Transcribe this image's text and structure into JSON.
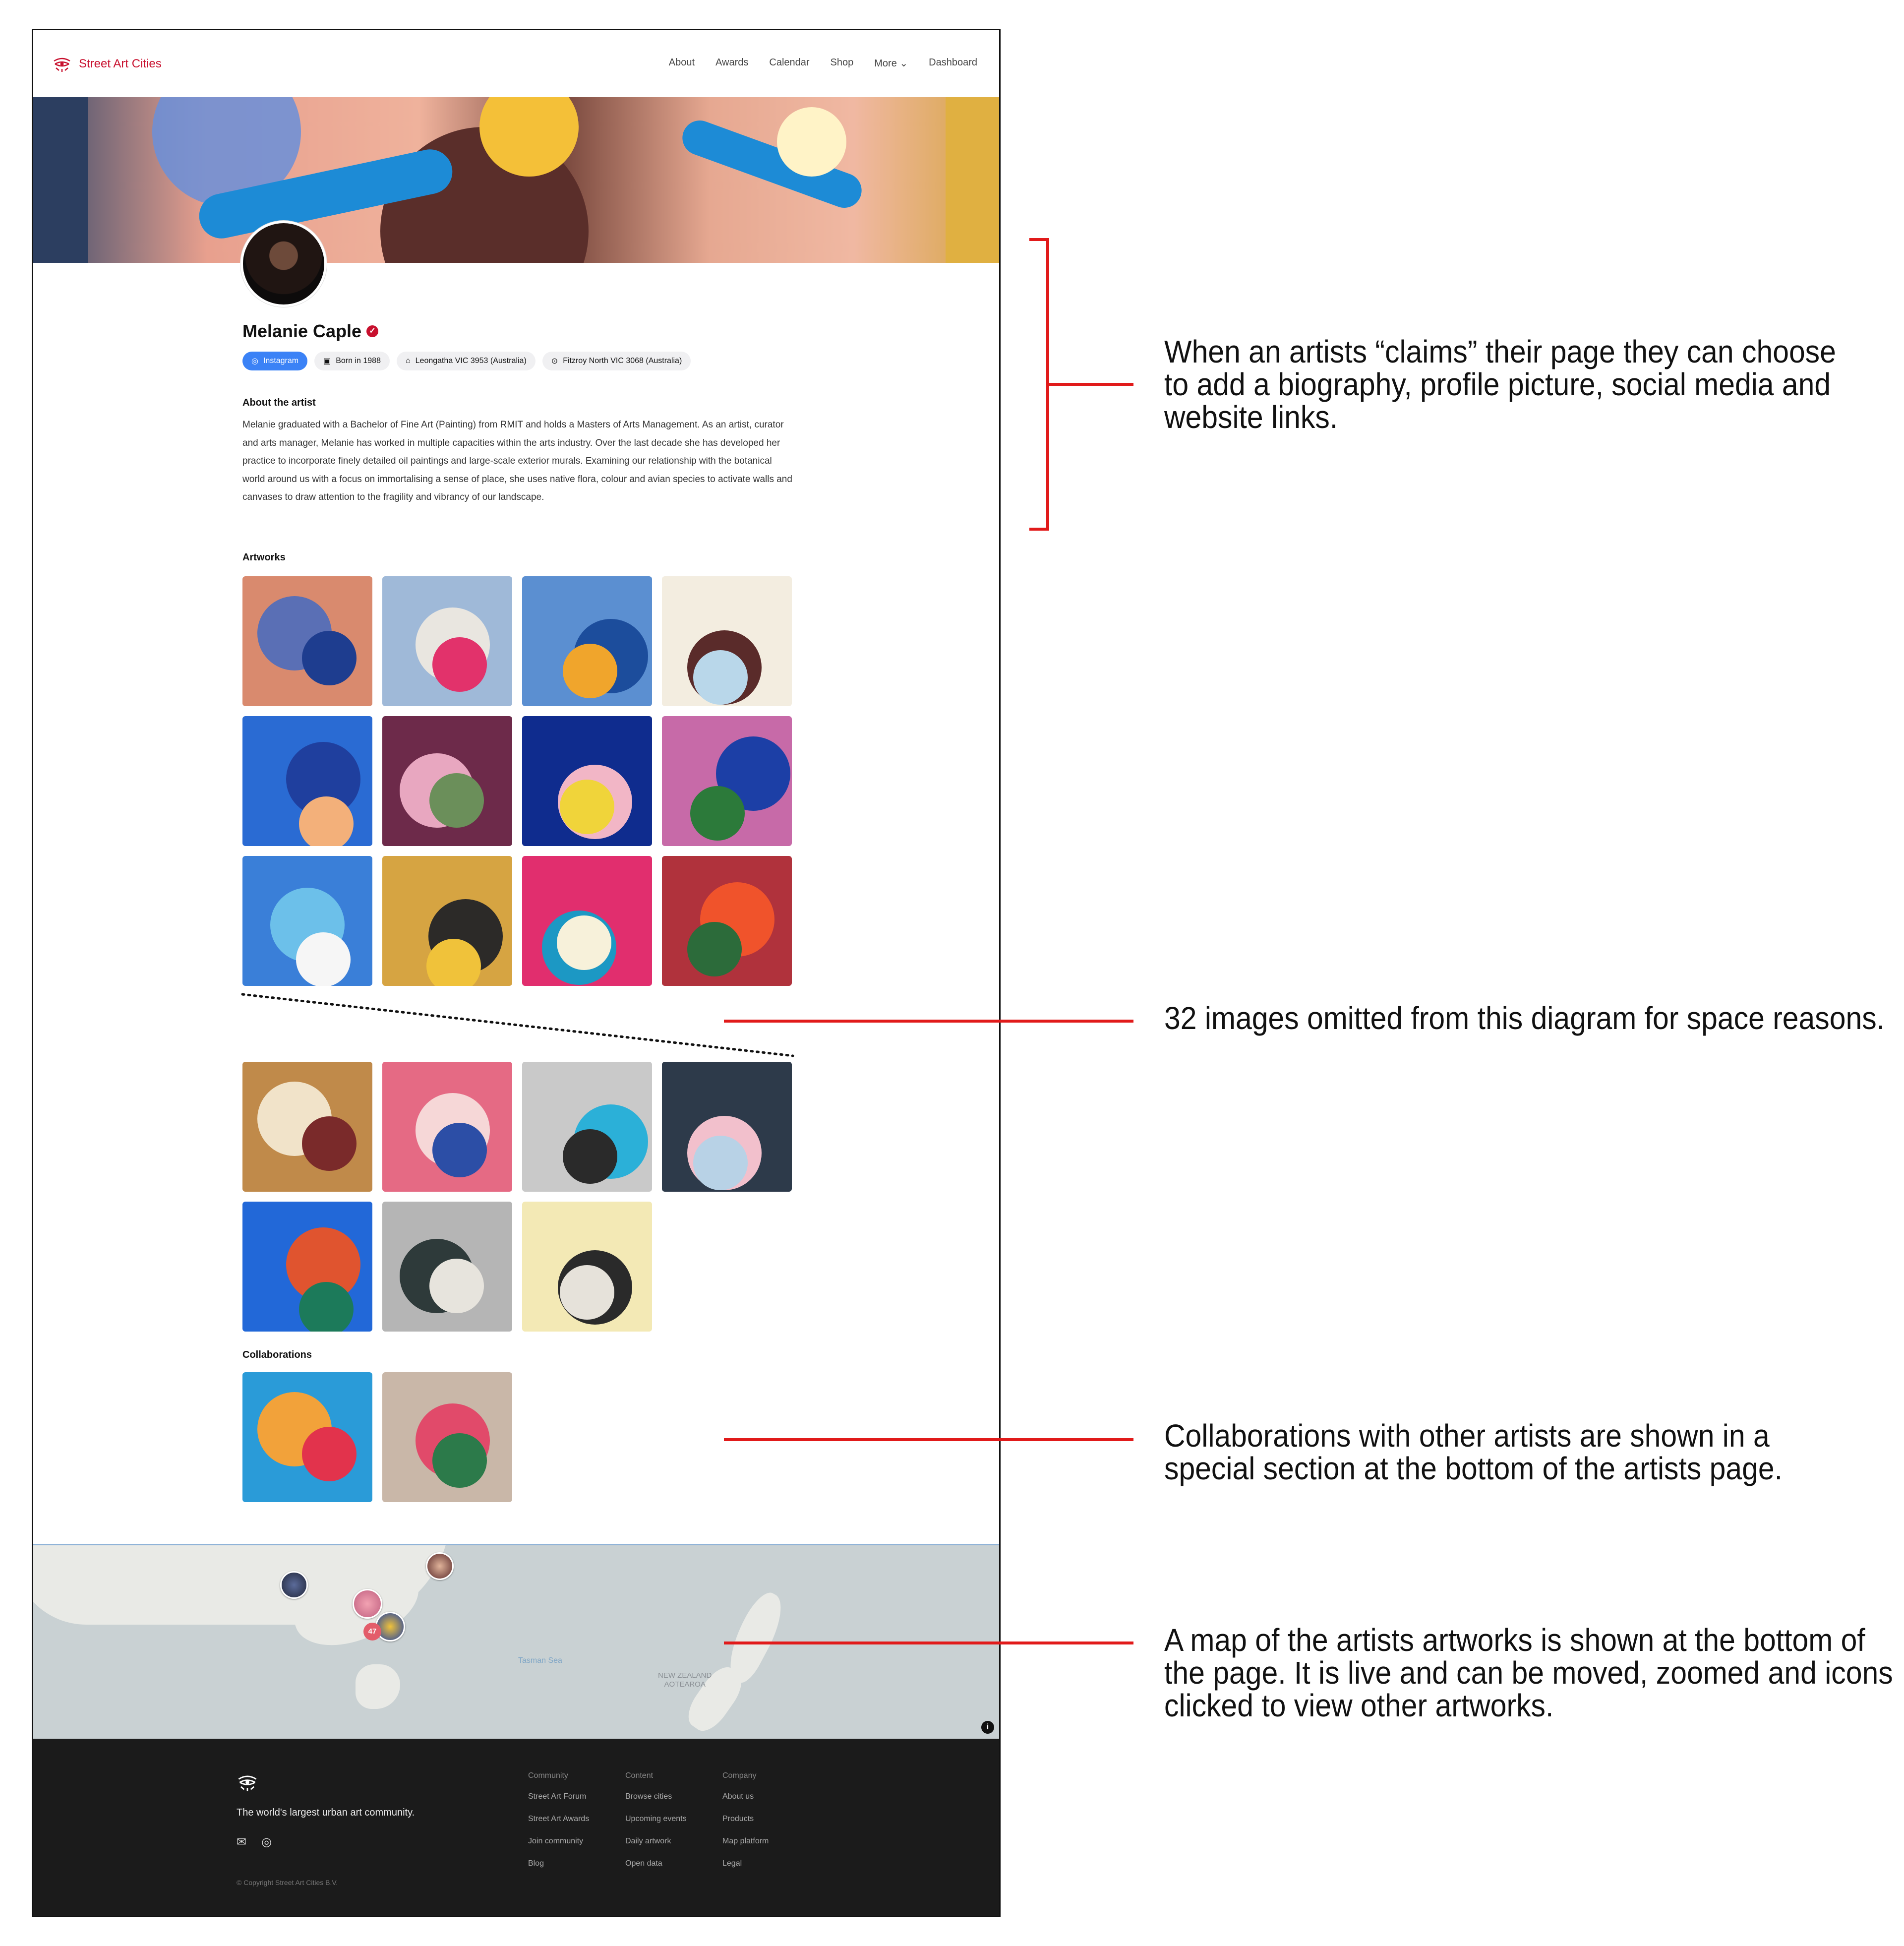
{
  "header": {
    "brand": "Street Art Cities",
    "nav": [
      "About",
      "Awards",
      "Calendar",
      "Shop",
      "More ⌄",
      "Dashboard"
    ]
  },
  "profile": {
    "name": "Melanie Caple",
    "chips": {
      "instagram": "Instagram",
      "born": "Born in 1988",
      "home": "Leongatha VIC 3953 (Australia)",
      "location": "Fitzroy North VIC 3068 (Australia)"
    },
    "about_title": "About the artist",
    "bio": "Melanie graduated with a Bachelor of Fine Art (Painting) from RMIT and holds a Masters of Arts Management. As an artist, curator and arts manager, Melanie has worked in multiple capacities within the arts industry. Over the last decade she has developed her practice to incorporate finely detailed oil paintings and large-scale exterior murals. Examining our relationship with the botanical world around us with a focus on immortalising a sense of place, she uses native flora, colour and avian species to activate walls and canvases to draw attention to the fragility and vibrancy of our landscape."
  },
  "artworks_title": "Artworks",
  "artworks_top": [
    {
      "c": [
        "#d98a6e",
        "#5a6fb5",
        "#1e3d8f"
      ]
    },
    {
      "c": [
        "#9fb9d8",
        "#e9e6e0",
        "#e2326b"
      ]
    },
    {
      "c": [
        "#5b8fd1",
        "#1c4d9c",
        "#f0a52c"
      ]
    },
    {
      "c": [
        "#f3ede0",
        "#5a2b2a",
        "#b9d7ea"
      ]
    },
    {
      "c": [
        "#2a6bd3",
        "#1f3f9e",
        "#f3b07a"
      ]
    },
    {
      "c": [
        "#6d2a4a",
        "#e8a7c0",
        "#6b8f5a"
      ]
    },
    {
      "c": [
        "#0f2c8e",
        "#f2b6c6",
        "#f0d43a"
      ]
    },
    {
      "c": [
        "#c76aa8",
        "#1c3fa6",
        "#2c7a3a"
      ]
    },
    {
      "c": [
        "#3a7fd8",
        "#6cc0ea",
        "#f6f6f6"
      ]
    },
    {
      "c": [
        "#d6a442",
        "#2c2a28",
        "#f0c23a"
      ]
    },
    {
      "c": [
        "#e12e6e",
        "#1c98c4",
        "#f7f1da"
      ]
    },
    {
      "c": [
        "#b0323c",
        "#f0532b",
        "#2c6b3a"
      ]
    }
  ],
  "artworks_bottom": [
    {
      "c": [
        "#c08a4a",
        "#f1e3c9",
        "#7a2a2a"
      ]
    },
    {
      "c": [
        "#e56a84",
        "#f6d7d7",
        "#2c4ea6"
      ]
    },
    {
      "c": [
        "#c9c9c9",
        "#2bb0d8",
        "#2a2a2a"
      ]
    },
    {
      "c": [
        "#2d3a4a",
        "#f2c0cc",
        "#b8d2e6"
      ]
    },
    {
      "c": [
        "#2268d8",
        "#e0542f",
        "#1c7a5a"
      ]
    },
    {
      "c": [
        "#b5b5b5",
        "#2e3a3a",
        "#e7e4dd"
      ]
    },
    {
      "c": [
        "#f3e9b5",
        "#2a2a2a",
        "#e6e2da"
      ]
    }
  ],
  "collaborations_title": "Collaborations",
  "collaborations": [
    {
      "c": [
        "#2a9bd8",
        "#f2a23a",
        "#e2334c"
      ]
    },
    {
      "c": [
        "#c9b7a8",
        "#e14a6a",
        "#2c7a4a"
      ]
    }
  ],
  "map": {
    "sea_label": "Tasman Sea",
    "nz_label": [
      "NEW ZEALAND",
      "AOTEAROA"
    ],
    "cluster_count": "47"
  },
  "footer": {
    "tagline": "The world's largest urban art community.",
    "copyright": "© Copyright Street Art Cities B.V.",
    "columns": [
      {
        "title": "Community",
        "items": [
          "Street Art Forum",
          "Street Art Awards",
          "Join community",
          "Blog"
        ]
      },
      {
        "title": "Content",
        "items": [
          "Browse cities",
          "Upcoming events",
          "Daily artwork",
          "Open data"
        ]
      },
      {
        "title": "Company",
        "items": [
          "About us",
          "Products",
          "Map platform",
          "Legal"
        ]
      }
    ]
  },
  "annotations": {
    "claims": "When an artists “claims” their page they can choose to add a biography, profile picture, social media and website links.",
    "omitted": "32 images omitted from this diagram for space reasons.",
    "collabs": "Collaborations with other artists are shown in a special section at the bottom of the artists page.",
    "map": "A map of the artists artworks is shown at the bottom of the page. It is live and can be moved, zoomed and icons clicked to view other artworks."
  },
  "colors": {
    "brand_red": "#c8102e",
    "annotation_red": "#e11a1a",
    "instagram_blue": "#3b82f6",
    "footer_bg": "#1b1b1b"
  }
}
